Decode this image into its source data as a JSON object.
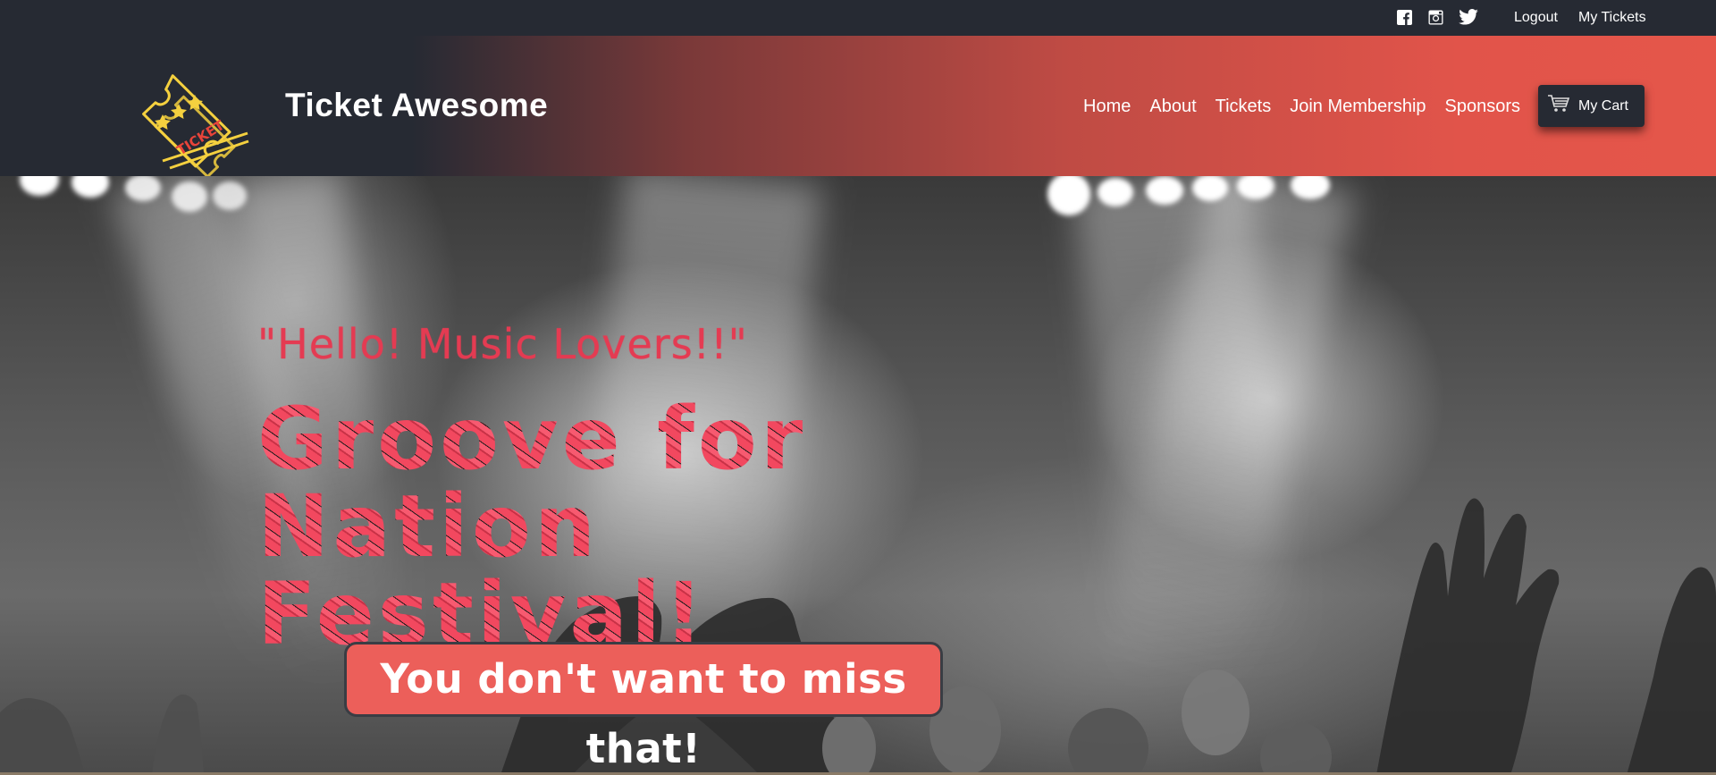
{
  "topbar": {
    "social": [
      {
        "name": "facebook-icon"
      },
      {
        "name": "instagram-icon"
      },
      {
        "name": "twitter-icon"
      }
    ],
    "links": {
      "logout": "Logout",
      "my_tickets": "My Tickets"
    }
  },
  "header": {
    "brand": "Ticket Awesome",
    "logo_text": "TICKET",
    "nav": [
      "Home",
      "About",
      "Tickets",
      "Join Membership",
      "Sponsors"
    ],
    "cart_label": "My Cart",
    "gradient_colors": [
      "#262a33",
      "#e5564a"
    ]
  },
  "hero": {
    "tagline": "\"Hello! Music Lovers!!\"",
    "title_line1": "Groove for Nation",
    "title_line2": "Festival!",
    "cta": "You don't want to miss that!",
    "accent_color": "#ec5f5a",
    "title_color": "#f2485f"
  }
}
